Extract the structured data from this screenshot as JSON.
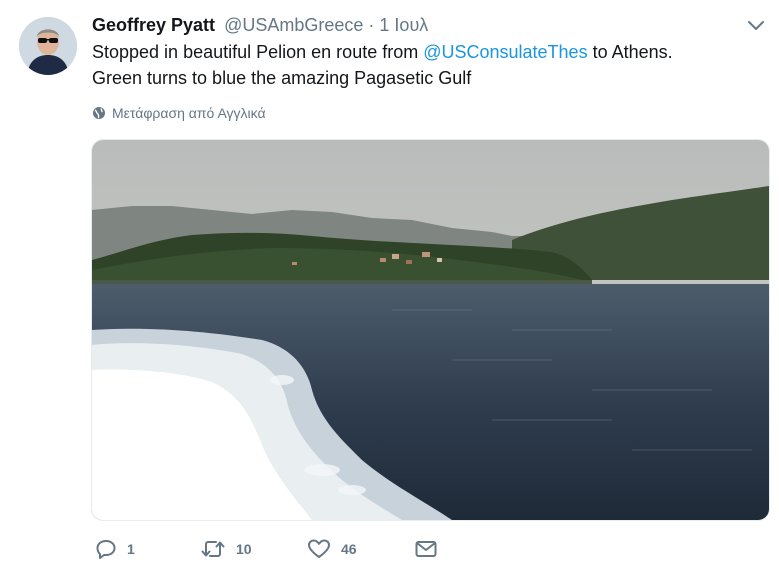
{
  "tweet": {
    "author_name": "Geoffrey Pyatt",
    "author_handle": "@USAmbGreece",
    "separator": "·",
    "date": "1 Ιουλ",
    "text_part1": "Stopped in beautiful Pelion en route from ",
    "mention": "@USConsulateThes",
    "text_part2": " to Athens.",
    "text_line2": "Green turns to blue the amazing Pagasetic Gulf",
    "translate_label": "Μετάφραση από Αγγλικά"
  },
  "actions": {
    "reply_count": "1",
    "retweet_count": "10",
    "like_count": "46"
  },
  "icons": {
    "menu": "chevron-down-icon",
    "translate": "globe-icon",
    "reply": "reply-icon",
    "retweet": "retweet-icon",
    "like": "heart-icon",
    "dm": "envelope-icon"
  },
  "colors": {
    "link": "#1b95e0",
    "secondary": "#657786",
    "text": "#14171a"
  }
}
